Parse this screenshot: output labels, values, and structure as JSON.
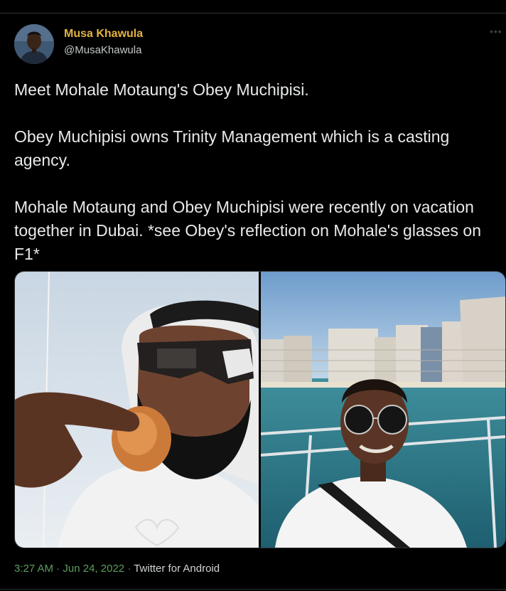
{
  "tweet": {
    "author": {
      "name": "Musa Khawula",
      "handle": "@MusaKhawula"
    },
    "paragraphs": [
      "Meet Mohale Motaung's Obey Muchipisi.",
      "Obey Muchipisi owns Trinity Management which is a casting agency.",
      "Mohale Motaung and Obey Muchipisi were recently on vacation together in Dubai. *see Obey's reflection on Mohale's glasses on F1*"
    ],
    "time": "3:27 AM",
    "separator": "·",
    "date": "Jun 24, 2022",
    "source": "Twitter for Android"
  },
  "icons": {
    "more": "more-options-icon"
  }
}
